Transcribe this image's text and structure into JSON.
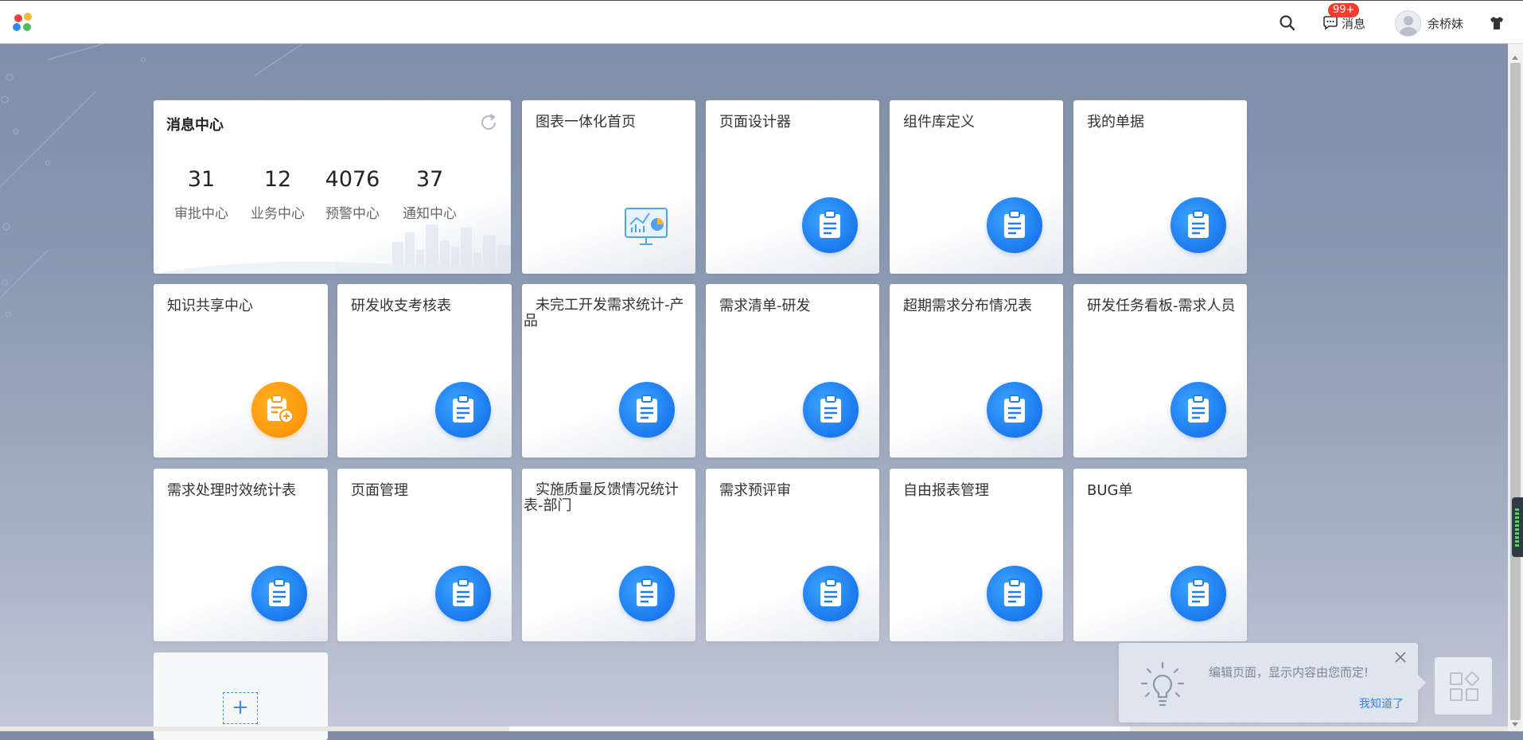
{
  "header": {
    "message_label": "消息",
    "message_badge": "99+",
    "user_name": "余桥妹"
  },
  "message_center": {
    "title": "消息中心",
    "stats": [
      {
        "value": "31",
        "label": "审批中心"
      },
      {
        "value": "12",
        "label": "业务中心"
      },
      {
        "value": "4076",
        "label": "预警中心"
      },
      {
        "value": "37",
        "label": "通知中心"
      }
    ]
  },
  "apps": [
    {
      "title": "图表一体化首页",
      "icon": "chart-monitor-icon"
    },
    {
      "title": "页面设计器",
      "icon": "clipboard-icon"
    },
    {
      "title": "组件库定义",
      "icon": "clipboard-icon"
    },
    {
      "title": "我的单据",
      "icon": "clipboard-icon"
    },
    {
      "title": "知识共享中心",
      "icon": "clipboard-add-icon",
      "color": "#ff9a0d"
    },
    {
      "title": "研发收支考核表",
      "icon": "clipboard-icon"
    },
    {
      "title": "未完工开发需求统计-产品",
      "icon": "clipboard-icon"
    },
    {
      "title": "需求清单-研发",
      "icon": "clipboard-icon"
    },
    {
      "title": "超期需求分布情况表",
      "icon": "clipboard-icon"
    },
    {
      "title": "研发任务看板-需求人员",
      "icon": "clipboard-icon"
    },
    {
      "title": "需求处理时效统计表",
      "icon": "clipboard-icon"
    },
    {
      "title": "页面管理",
      "icon": "clipboard-icon"
    },
    {
      "title": "实施质量反馈情况统计表-部门",
      "icon": "clipboard-icon"
    },
    {
      "title": "需求预评审",
      "icon": "clipboard-icon"
    },
    {
      "title": "自由报表管理",
      "icon": "clipboard-icon"
    },
    {
      "title": "BUG单",
      "icon": "clipboard-icon"
    }
  ],
  "add_card": {
    "label": "+"
  },
  "tip": {
    "text": "编辑页面，显示内容由您而定!",
    "confirm": "我知道了"
  },
  "colors": {
    "accent": "#1f7ff0",
    "orange": "#ff9a0d",
    "badge": "#f23c2c"
  }
}
